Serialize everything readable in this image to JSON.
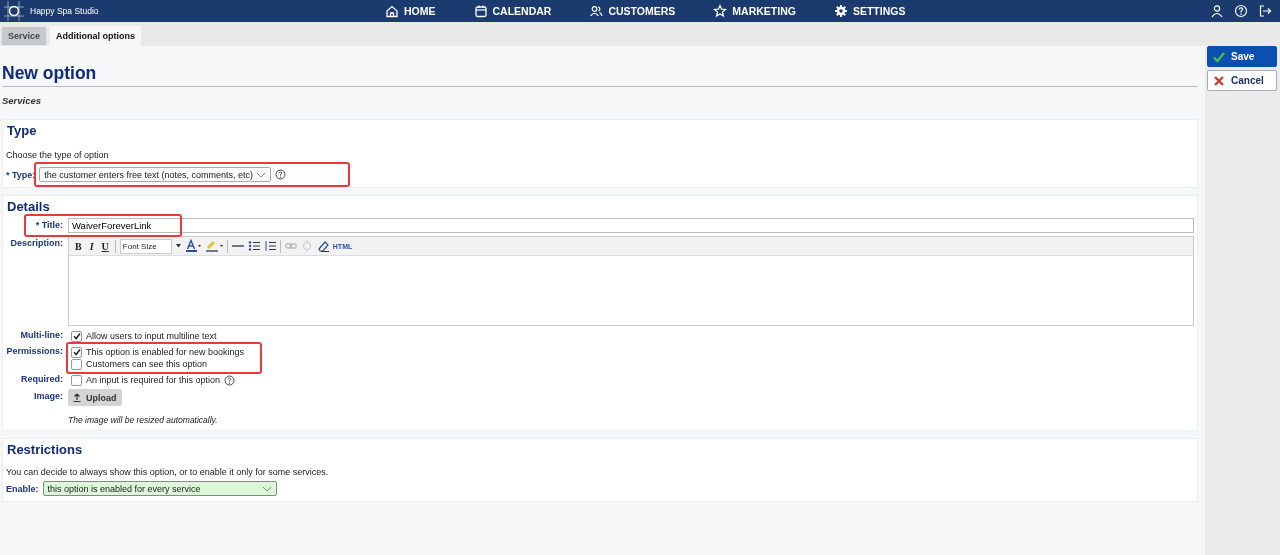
{
  "app": {
    "name": "Happy Spa Studio"
  },
  "nav": [
    {
      "label": "HOME"
    },
    {
      "label": "CALENDAR"
    },
    {
      "label": "CUSTOMERS"
    },
    {
      "label": "MARKETING"
    },
    {
      "label": "SETTINGS"
    }
  ],
  "tabs": [
    {
      "label": "Service",
      "selected": false
    },
    {
      "label": "Additional options",
      "selected": true
    }
  ],
  "page": {
    "title": "New option",
    "subtitle": "Services"
  },
  "actions": [
    {
      "kind": "save",
      "label": "Save"
    },
    {
      "kind": "cancel",
      "label": "Cancel"
    }
  ],
  "type_section": {
    "heading": "Type",
    "hint": "Choose the type of option",
    "label": "* Type:",
    "value": "the customer enters free text (notes, comments, etc)",
    "highlighted": true
  },
  "details": {
    "heading": "Details",
    "title": {
      "label": "* Title:",
      "value": "WaiverForeverLink",
      "highlighted": true
    },
    "description": {
      "label": "Description:",
      "toolbar": {
        "bold": "B",
        "italic": "I",
        "underline": "U",
        "font_size": "Font Size",
        "html": "HTML"
      }
    },
    "multiline": {
      "label": "Multi-line:",
      "highlighted": false,
      "options": [
        {
          "text": "Allow users to input multiline text",
          "checked": true
        }
      ]
    },
    "permissions": {
      "label": "Permissions:",
      "highlighted": true,
      "options": [
        {
          "text": "This option is enabled for new bookings",
          "checked": true
        },
        {
          "text": "Customers can see this option",
          "checked": false
        }
      ]
    },
    "required": {
      "label": "Required:",
      "highlighted": false,
      "options": [
        {
          "text": "An input is required for this option",
          "checked": false
        }
      ]
    },
    "image": {
      "label": "Image:",
      "button": "Upload",
      "note": "The image will be resized automatically."
    }
  },
  "restrictions": {
    "heading": "Restrictions",
    "text": "You can decide to always show this option, or to enable it only for some services.",
    "label": "Enable:",
    "value": "this option is enabled for every service"
  }
}
